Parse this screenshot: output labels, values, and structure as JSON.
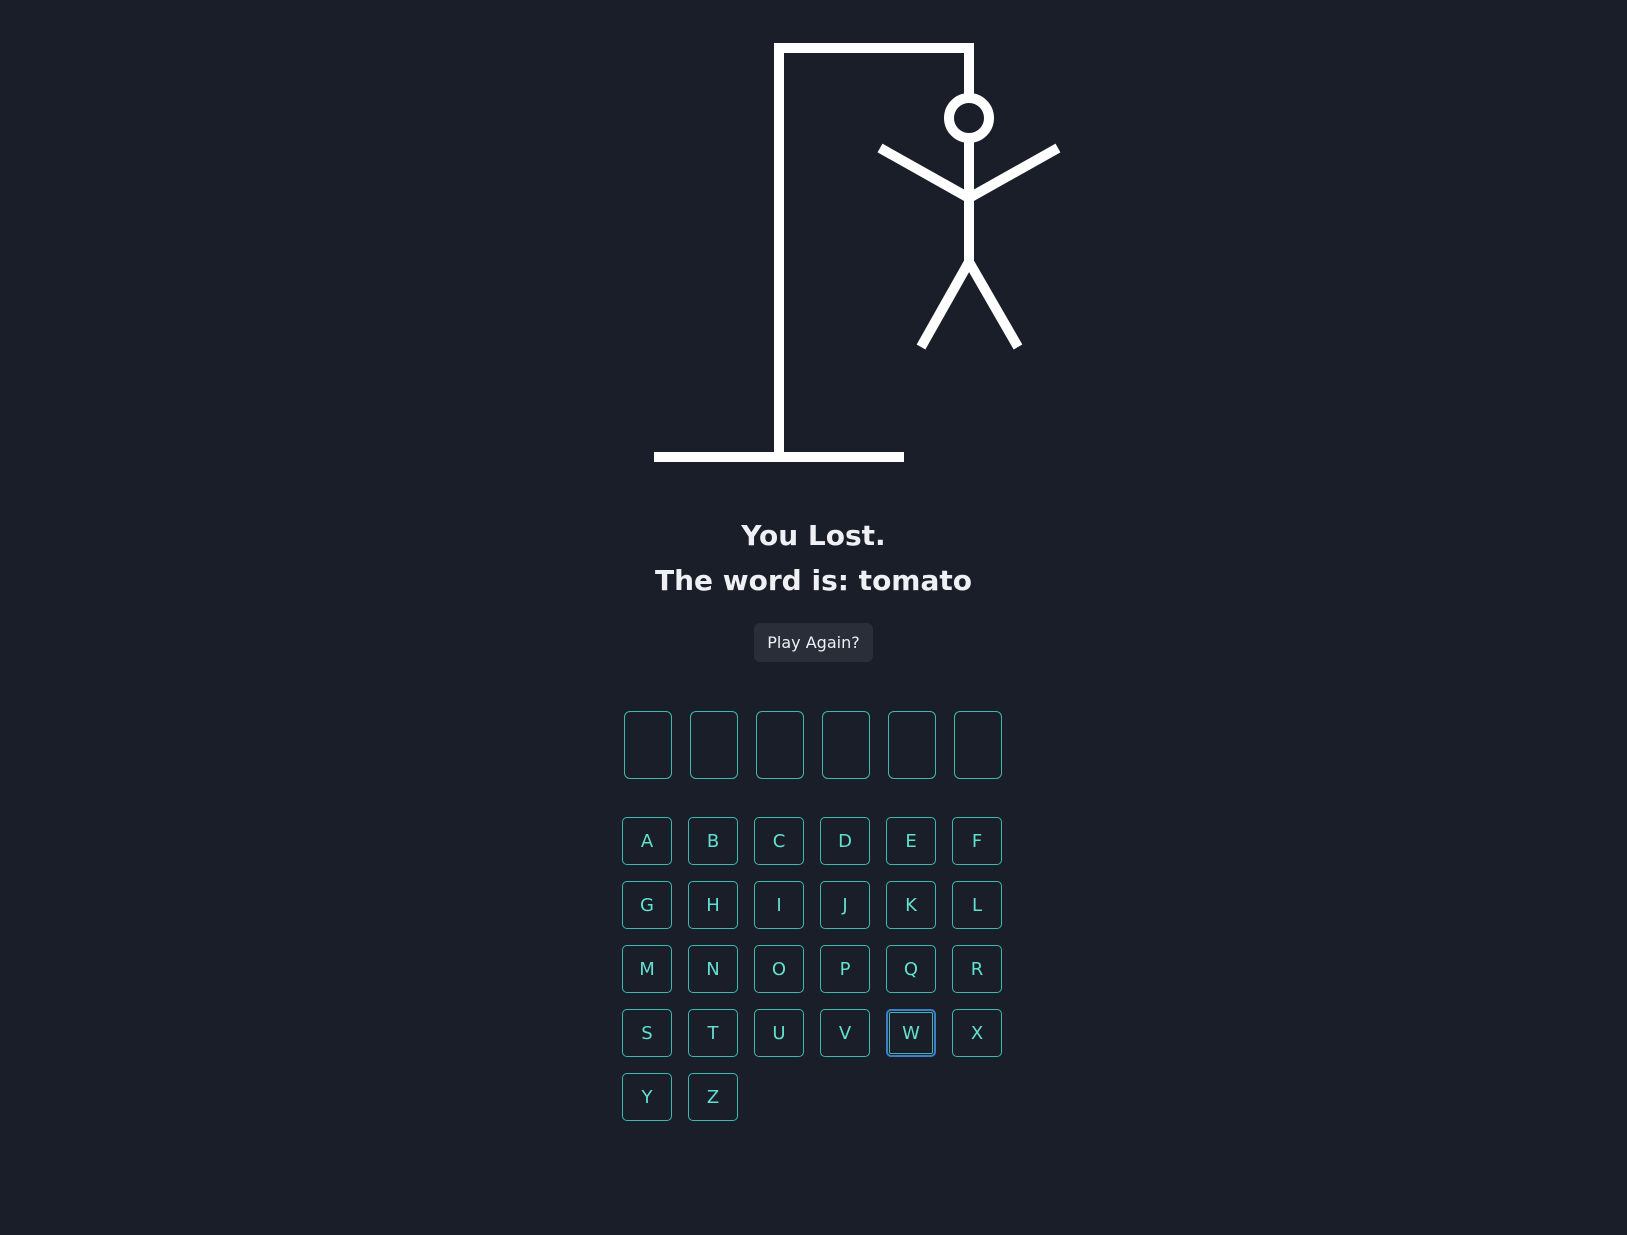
{
  "status": {
    "result": "You Lost.",
    "word_line": "The word is: tomato"
  },
  "play_again_label": "Play Again?",
  "word_slots": [
    "",
    "",
    "",
    "",
    "",
    ""
  ],
  "keyboard": [
    "A",
    "B",
    "C",
    "D",
    "E",
    "F",
    "G",
    "H",
    "I",
    "J",
    "K",
    "L",
    "M",
    "N",
    "O",
    "P",
    "Q",
    "R",
    "S",
    "T",
    "U",
    "V",
    "W",
    "X",
    "Y",
    "Z"
  ],
  "focused_key": "W",
  "colors": {
    "background": "#1a1e28",
    "accent": "#62e0d0",
    "key_border": "#3eb8b0",
    "focus_ring": "#3d7ec8",
    "drawing": "#ffffff"
  }
}
